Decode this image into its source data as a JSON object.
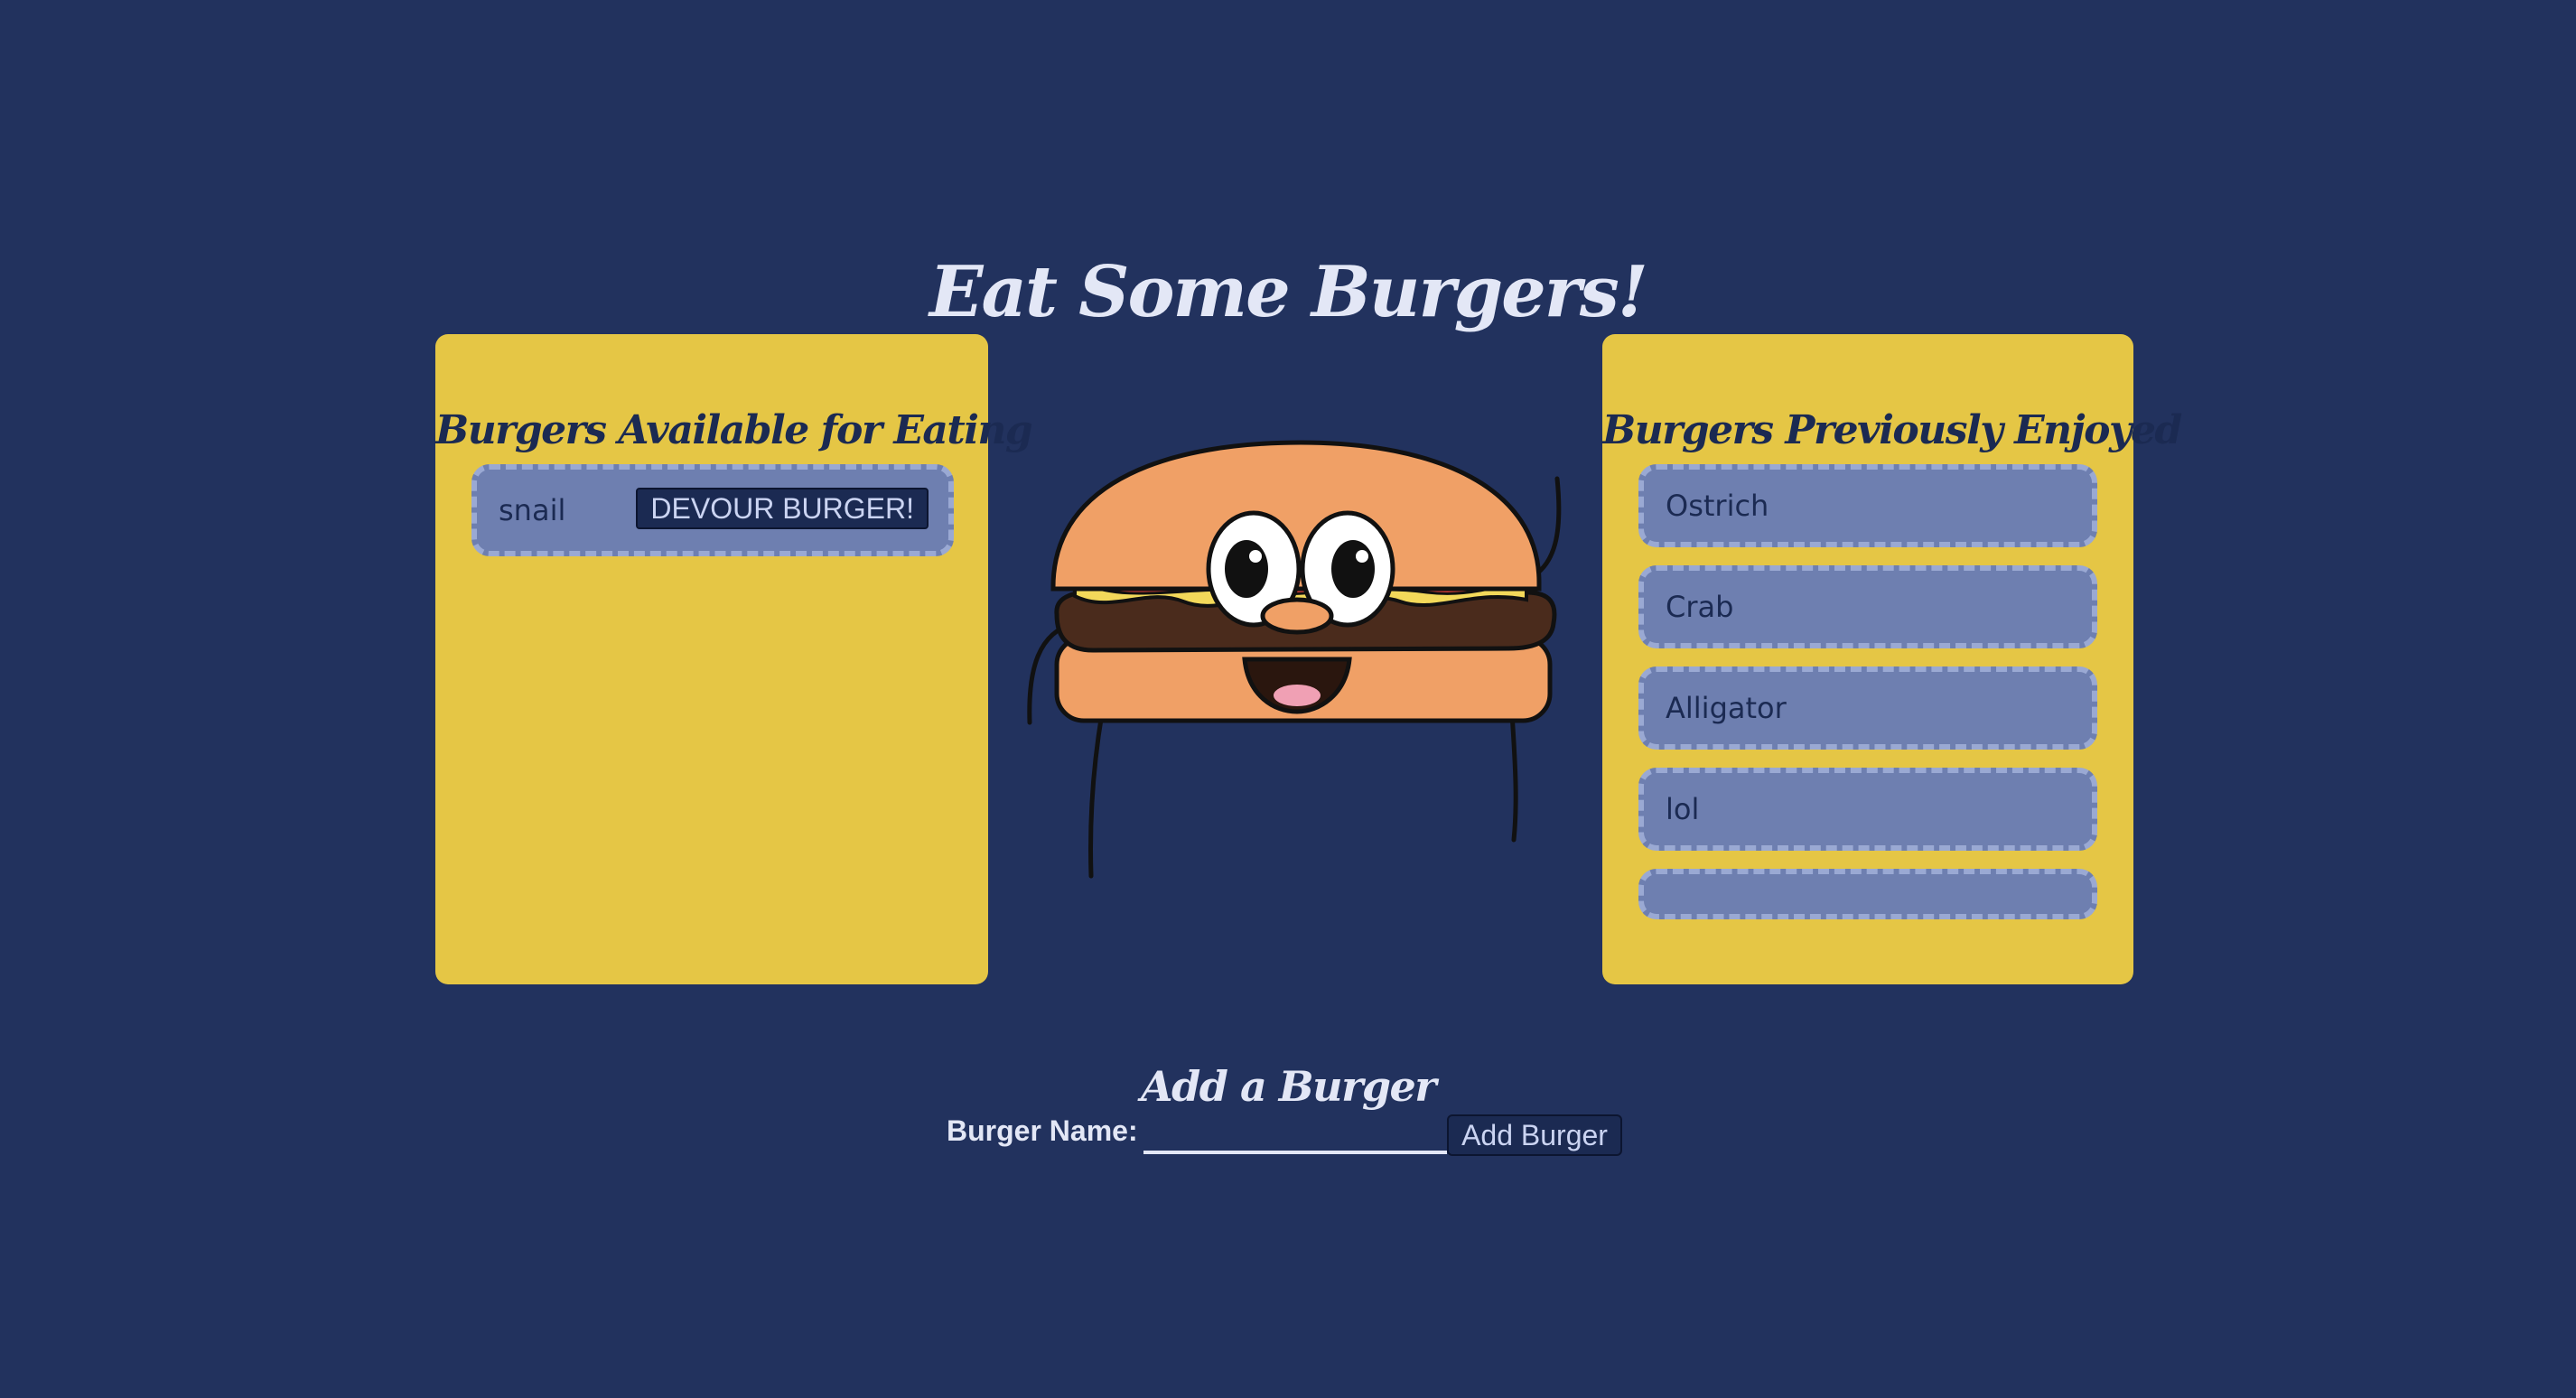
{
  "page": {
    "title": "Eat Some Burgers!"
  },
  "available": {
    "heading": "Burgers Available for Eating",
    "items": [
      {
        "name": "snail",
        "button_label": "DEVOUR BURGER!"
      }
    ]
  },
  "enjoyed": {
    "heading": "Burgers Previously Enjoyed",
    "items": [
      {
        "name": "Ostrich"
      },
      {
        "name": "Crab"
      },
      {
        "name": "Alligator"
      },
      {
        "name": "lol"
      },
      {
        "name": ""
      }
    ]
  },
  "form": {
    "heading": "Add a Burger",
    "label": "Burger Name:",
    "input_value": "",
    "submit_label": "Add Burger"
  },
  "mascot": {
    "icon": "burger-mascot-icon"
  },
  "colors": {
    "background": "#22325e",
    "panel": "#e5c645",
    "item": "#6e7fb0",
    "item_border": "#9aa9d3",
    "button": "#1b2a52",
    "text_light": "#e3e7f6"
  }
}
